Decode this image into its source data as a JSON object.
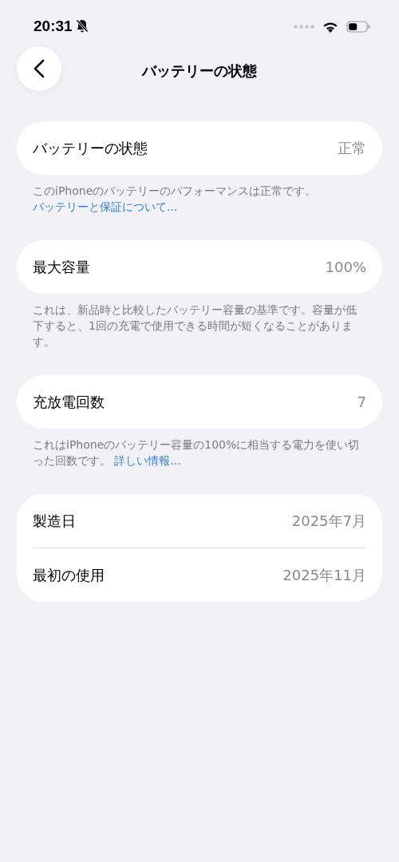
{
  "status_bar": {
    "time": "20:31"
  },
  "nav": {
    "title": "バッテリーの状態"
  },
  "groups": [
    {
      "rows": [
        {
          "label": "バッテリーの状態",
          "value": "正常"
        }
      ],
      "footer": {
        "text": "このiPhoneのバッテリーのパフォーマンスは正常です。",
        "link": "バッテリーと保証について..."
      }
    },
    {
      "rows": [
        {
          "label": "最大容量",
          "value": "100%"
        }
      ],
      "footer": {
        "text": "これは、新品時と比較したバッテリー容量の基準です。容量が低下すると、1回の充電で使用できる時間が短くなることがあります。"
      }
    },
    {
      "rows": [
        {
          "label": "充放電回数",
          "value": "7"
        }
      ],
      "footer": {
        "text": "これはiPhoneのバッテリー容量の100%に相当する電力を使い切った回数です。",
        "link": "詳しい情報..."
      }
    },
    {
      "rows": [
        {
          "label": "製造日",
          "value": "2025年7月"
        },
        {
          "label": "最初の使用",
          "value": "2025年11月"
        }
      ]
    }
  ]
}
